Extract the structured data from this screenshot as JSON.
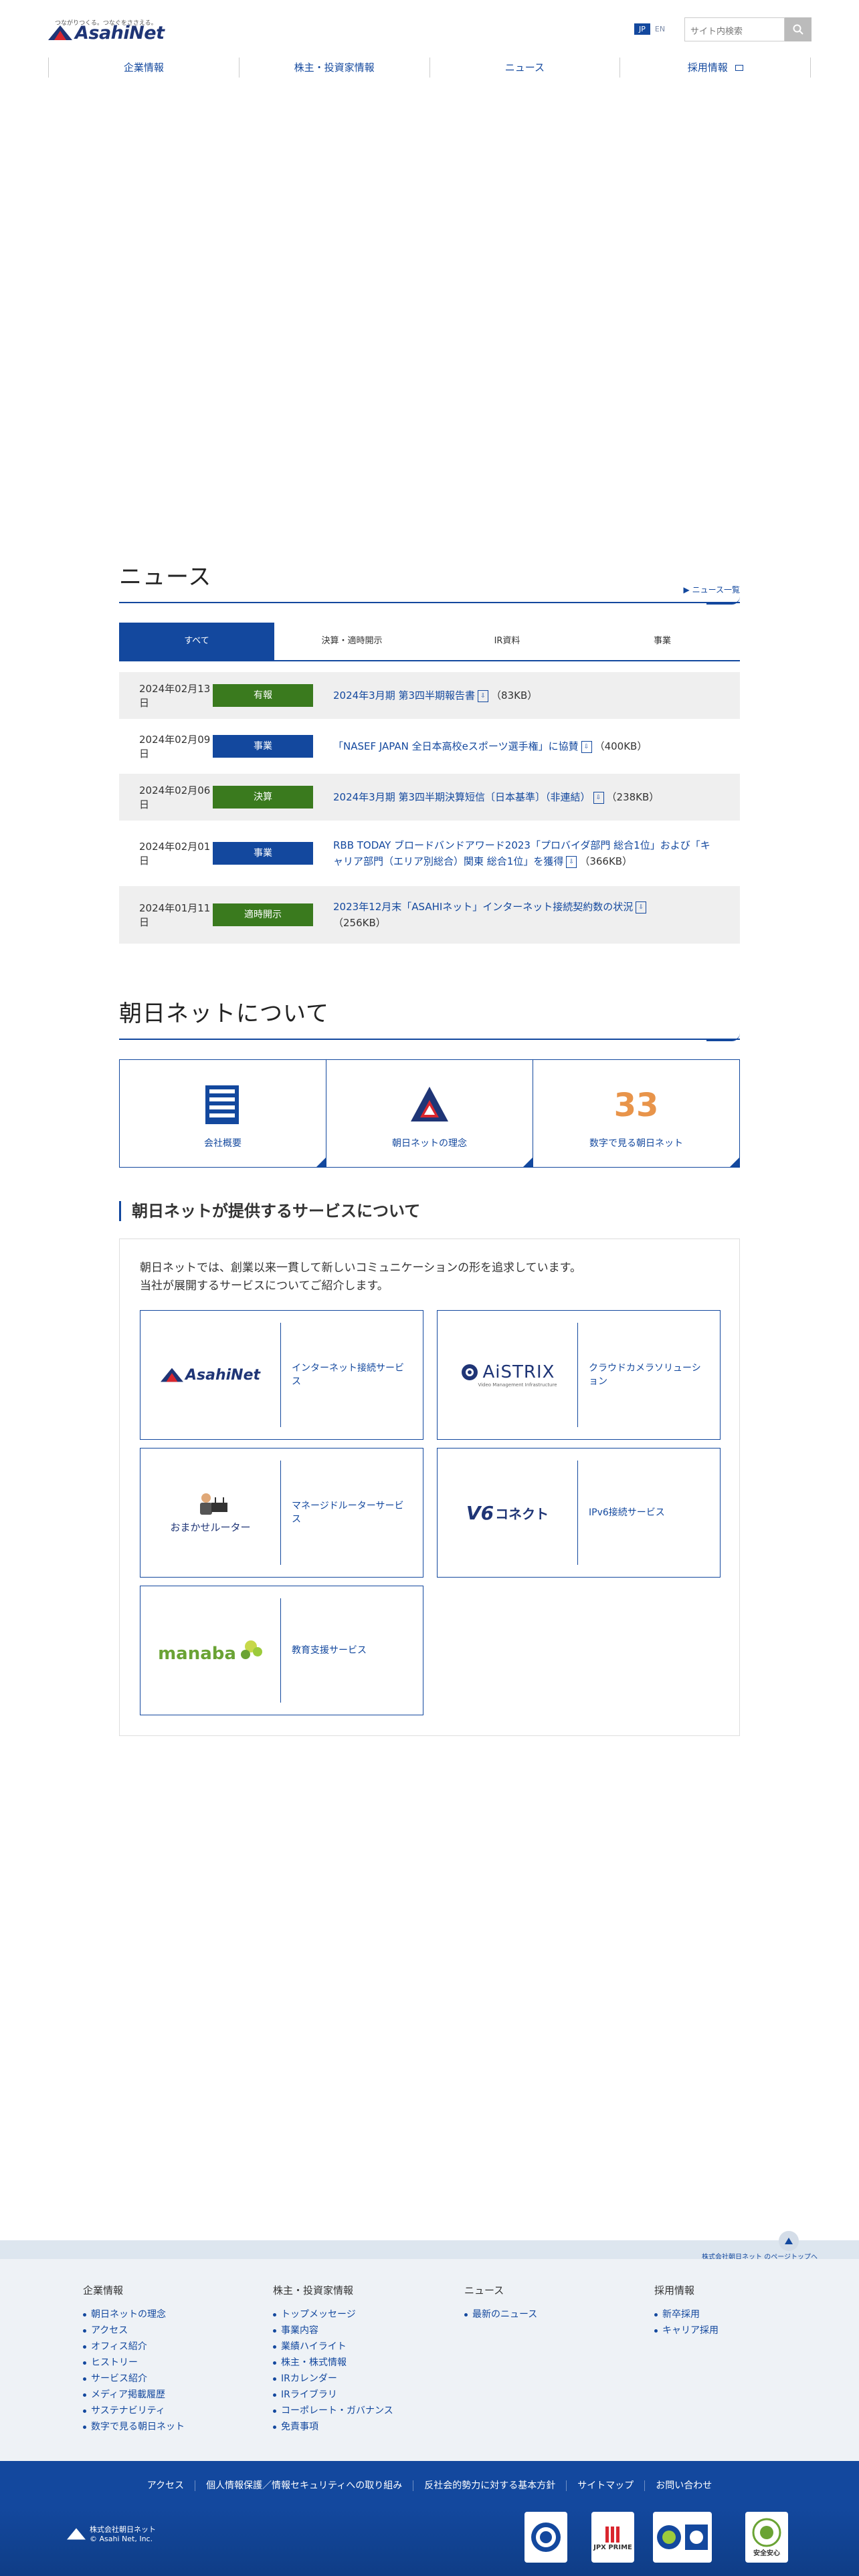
{
  "header": {
    "logo_tagline": "つながりつくる。つなぐをささえる。",
    "logo_text": "AsahiNet",
    "lang_jp": "JP",
    "lang_en": "EN",
    "search_placeholder": "サイト内検索",
    "nav": [
      "企業情報",
      "株主・投資家情報",
      "ニュース",
      "採用情報"
    ]
  },
  "news": {
    "title": "ニュース",
    "more": "ニュース一覧",
    "tabs": [
      "すべて",
      "決算・適時開示",
      "IR資料",
      "事業"
    ],
    "items": [
      {
        "date": "2024年02月13日",
        "category": "有報",
        "color": "#3a7a1e",
        "text": "2024年3月期 第3四半期報告書",
        "size": "（83KB）"
      },
      {
        "date": "2024年02月09日",
        "category": "事業",
        "color": "#13489e",
        "text": "「NASEF JAPAN 全日本高校eスポーツ選手権」に協賛",
        "size": "（400KB）"
      },
      {
        "date": "2024年02月06日",
        "category": "決算",
        "color": "#3a7a1e",
        "text": "2024年3月期 第3四半期決算短信〔日本基準〕（非連結）",
        "size": "（238KB）"
      },
      {
        "date": "2024年02月01日",
        "category": "事業",
        "color": "#13489e",
        "text": "RBB TODAY ブロードバンドアワード2023「プロバイダ部門 総合1位」および「キャリア部門（エリア別総合）関東 総合1位」を獲得",
        "size": "（366KB）"
      },
      {
        "date": "2024年01月11日",
        "category": "適時開示",
        "color": "#3a7a1e",
        "text": "2023年12月末「ASAHIネット」インターネット接続契約数の状況",
        "size": "（256KB）"
      }
    ]
  },
  "about": {
    "title": "朝日ネットについて",
    "cards": [
      "会社概要",
      "朝日ネットの理念",
      "数字で見る朝日ネット"
    ],
    "number": "33"
  },
  "services": {
    "title": "朝日ネットが提供するサービスについて",
    "intro_1": "朝日ネットでは、創業以来一貫して新しいコミュニケーションの形を追求しています。",
    "intro_2": "当社が展開するサービスについてご紹介します。",
    "items": [
      {
        "logo": "AsahiNet",
        "desc": "インターネット接続サービス"
      },
      {
        "logo": "AiSTRIX",
        "sub": "Video Management Infrastructure",
        "desc": "クラウドカメラソリューション"
      },
      {
        "logo": "おまかせルーター",
        "desc": "マネージドルーターサービス"
      },
      {
        "logo": "コネクト",
        "desc": "IPv6接続サービス"
      },
      {
        "logo": "manaba",
        "desc": "教育支援サービス"
      }
    ]
  },
  "footer": {
    "crumb": "株式会社朝日ネット のページトップへ",
    "cols": [
      {
        "title": "企業情報",
        "links": [
          "朝日ネットの理念",
          "アクセス",
          "オフィス紹介",
          "ヒストリー",
          "サービス紹介",
          "メディア掲載履歴",
          "サステナビリティ",
          "数字で見る朝日ネット"
        ]
      },
      {
        "title": "株主・投資家情報",
        "links": [
          "トップメッセージ",
          "事業内容",
          "業績ハイライト",
          "株主・株式情報",
          "IRカレンダー",
          "IRライブラリ",
          "コーポレート・ガバナンス",
          "免責事項"
        ]
      },
      {
        "title": "ニュース",
        "links": [
          "最新のニュース"
        ]
      },
      {
        "title": "採用情報",
        "links": [
          "新卒採用",
          "キャリア採用"
        ]
      }
    ],
    "bottom_links": [
      "アクセス",
      "個人情報保護／情報セキュリティへの取り組み",
      "反社会的勢力に対する基本方針",
      "サイトマップ",
      "お問い合わせ"
    ],
    "company": "株式会社朝日ネット",
    "copyright": "© Asahi Net, Inc.",
    "badges": [
      "JPX PRIME",
      "安全安心"
    ]
  }
}
